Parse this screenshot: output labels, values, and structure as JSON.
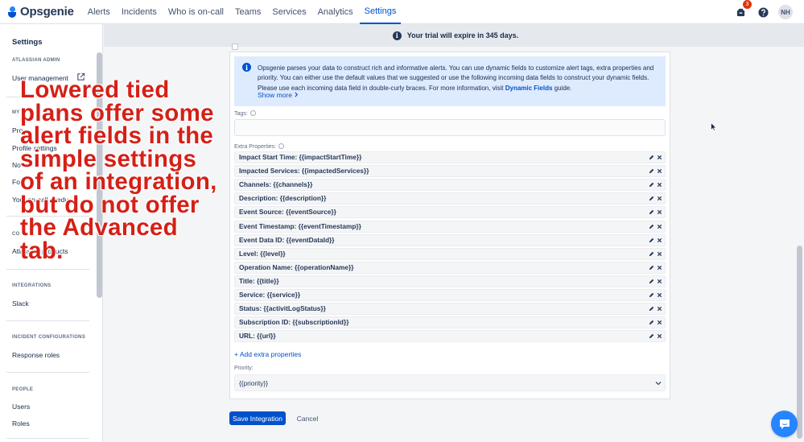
{
  "app": {
    "logo_text": "Opsgenie"
  },
  "nav": {
    "items": [
      "Alerts",
      "Incidents",
      "Who is on-call",
      "Teams",
      "Services",
      "Analytics",
      "Settings"
    ],
    "active": "Settings",
    "notification_count": "3",
    "avatar_initials": "NH"
  },
  "banner": {
    "text": "Your trial will expire in 345 days."
  },
  "sidebar": {
    "title": "Settings",
    "section_atlassian_admin": "ATLASSIAN ADMIN",
    "user_management": "User management",
    "section_my": "MY",
    "item_pro": "Pro",
    "profile_settings": "Profile settings",
    "item_no": "No",
    "item_fo": "Fo",
    "your_oncall": "Your on-call",
    "item_chedu": "chedu",
    "section_co": "CO",
    "atlassian_products": "Atlassian products",
    "section_integrations": "INTEGRATIONS",
    "slack": "Slack",
    "section_incident_configurations": "INCIDENT CONFIGURATIONS",
    "response_roles": "Response roles",
    "section_people": "PEOPLE",
    "users": "Users",
    "roles": "Roles"
  },
  "info_panel": {
    "text": "Opsgenie parses your data to construct rich and informative alerts. You can use dynamic fields to customize alert tags, extra properties and priority. You can either use the default values that we suggested or use the following incoming data fields to construct your dynamic fields. Please use each incoming data field in double-curly braces. For more information, visit",
    "link": "Dynamic Fields",
    "suffix": "guide.",
    "show_more": "Show more"
  },
  "form": {
    "tags_label": "Tags:",
    "extra_properties_label": "Extra Properties:",
    "extra_properties": [
      "Impact Start Time: {{impactStartTime}}",
      "Impacted Services: {{impactedServices}}",
      "Channels: {{channels}}",
      "Description: {{description}}",
      "Event Source: {{eventSource}}",
      "Event Timestamp: {{eventTimestamp}}",
      "Event Data ID: {{eventDataId}}",
      "Level: {{level}}",
      "Operation Name: {{operationName}}",
      "Title: {{title}}",
      "Service: {{service}}",
      "Status: {{activitLogStatus}}",
      "Subscription ID: {{subscriptionId}}",
      "URL: {{url}}"
    ],
    "add_extra_properties": "+ Add extra properties",
    "priority_label": "Priority:",
    "priority_value": "{{priority}}",
    "save_label": "Save Integration",
    "cancel_label": "Cancel"
  },
  "overlay": {
    "caption": "Lowered tied plans offer some alert fields in the simple settings of an integration, but do not offer the Advanced tab."
  },
  "colors": {
    "primary": "#0052cc",
    "overlay_text": "#d52017",
    "info_bg": "#deebff"
  }
}
